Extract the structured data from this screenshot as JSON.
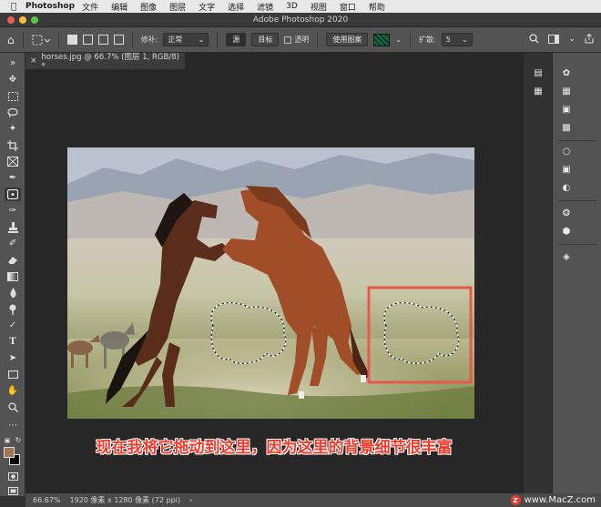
{
  "menubar": {
    "app_name": "Photoshop",
    "items": [
      "文件",
      "编辑",
      "图像",
      "图层",
      "文字",
      "选择",
      "滤镜",
      "3D",
      "视图",
      "窗口",
      "帮助"
    ]
  },
  "window": {
    "title": "Adobe Photoshop 2020"
  },
  "options": {
    "feather_label": "修补:",
    "mode_value": "正常",
    "source_label": "源",
    "dest_label": "目标",
    "transparent_label": "透明",
    "use_pattern_label": "使用图案",
    "diffusion_label": "扩散:",
    "diffusion_value": "5"
  },
  "document": {
    "tab_label": "horses.jpg @ 66.7% (图层 1, RGB/8) *"
  },
  "caption": "现在我将它拖动到这里，因为这里的背景细节很丰富",
  "status": {
    "zoom": "66.67%",
    "doc_info": "1920 像素 x 1280 像素 (72 ppi)"
  },
  "watermark": "www.MacZ.com",
  "colors": {
    "foreground": "#9c7754",
    "background": "#000000",
    "caption": "#f23b2b",
    "highlight_box": "#e8594a"
  }
}
